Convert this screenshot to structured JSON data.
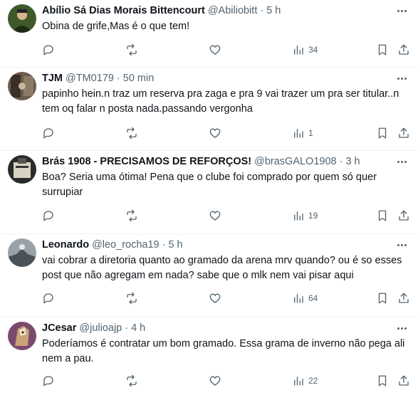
{
  "tweets": [
    {
      "name": "Abílio Sá Dias Morais Bittencourt",
      "handle": "@Abiliobitt",
      "time": "5 h",
      "text": "Obina de grife,Mas é o que tem!",
      "views": "34",
      "avatar_color": "#3f5a2a"
    },
    {
      "name": "TJM",
      "handle": "@TM0179",
      "time": "50 min",
      "text": "papinho hein.n traz um reserva pra zaga e pra 9 vai trazer um pra ser titular..n tem oq falar  n posta nada.passando vergonha",
      "views": "1",
      "avatar_color": "#6b5b4b"
    },
    {
      "name": "Brás 1908 - PRECISAMOS DE REFORÇOS!",
      "handle": "@brasGALO1908",
      "time": "3 h",
      "text": "Boa? Seria uma ótima! Pena que o clube foi comprado por quem só quer surrupiar",
      "views": "19",
      "avatar_color": "#2b2b2b"
    },
    {
      "name": "Leonardo",
      "handle": "@leo_rocha19",
      "time": "5 h",
      "text": "vai cobrar a diretoria quanto ao gramado da arena mrv quando? ou é so esses post que não agregam em nada? sabe que o mlk nem vai pisar aqui",
      "views": "64",
      "avatar_color": "#9aa3a8"
    },
    {
      "name": "JCesar",
      "handle": "@julioajp",
      "time": "4 h",
      "text": "Poderíamos é contratar um bom gramado.  Essa grama de inverno não pega ali nem a pau.",
      "views": "22",
      "avatar_color": "#7a4a6e"
    }
  ]
}
